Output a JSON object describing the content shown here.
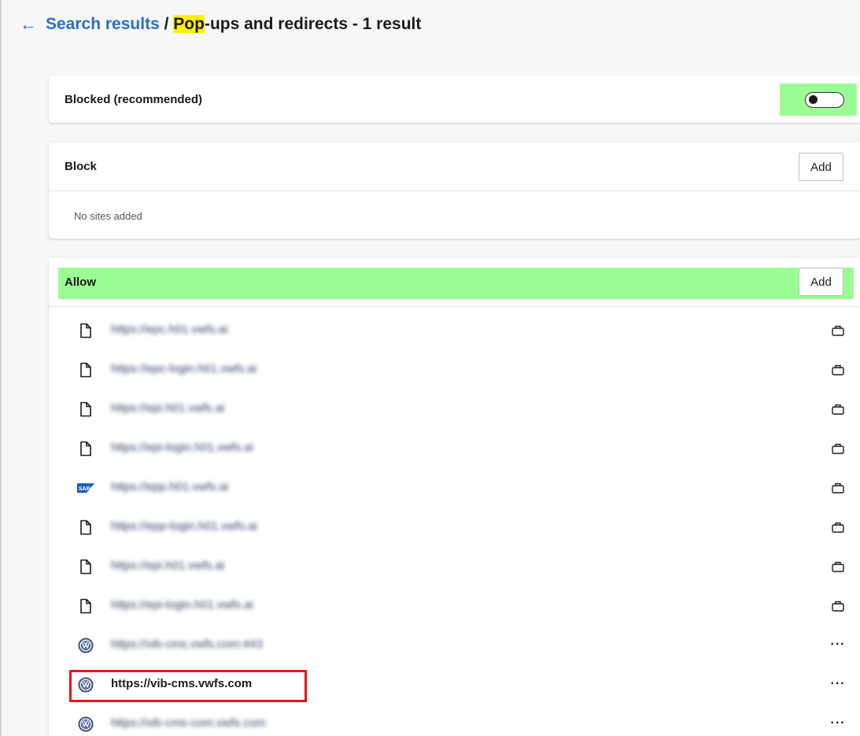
{
  "header": {
    "back_label": "←",
    "breadcrumb_link": "Search results",
    "separator": "/",
    "highlight": "Pop",
    "title_rest": "-ups and redirects - 1 result"
  },
  "blocked_card": {
    "label": "Blocked (recommended)",
    "toggle_on": false
  },
  "block_card": {
    "title": "Block",
    "add_label": "Add",
    "empty_text": "No sites added"
  },
  "allow_card": {
    "title": "Allow",
    "add_label": "Add",
    "sites": [
      {
        "url": "https://epc.h01.vwfs.ai",
        "icon": "file-icon",
        "action": "briefcase-icon",
        "blurred": true
      },
      {
        "url": "https://epc-login.h01.vwfs.ai",
        "icon": "file-icon",
        "action": "briefcase-icon",
        "blurred": true
      },
      {
        "url": "https://epi.h01.vwfs.ai",
        "icon": "file-icon",
        "action": "briefcase-icon",
        "blurred": true
      },
      {
        "url": "https://epi-login.h01.vwfs.ai",
        "icon": "file-icon",
        "action": "briefcase-icon",
        "blurred": true
      },
      {
        "url": "https://epp.h01.vwfs.ai",
        "icon": "sap-icon",
        "action": "briefcase-icon",
        "blurred": true
      },
      {
        "url": "https://epp-login.h01.vwfs.ai",
        "icon": "file-icon",
        "action": "briefcase-icon",
        "blurred": true
      },
      {
        "url": "https://epi.h01.vwfs.ai",
        "icon": "file-icon",
        "action": "briefcase-icon",
        "blurred": true
      },
      {
        "url": "https://epi-login.h01.vwfs.ai",
        "icon": "file-icon",
        "action": "briefcase-icon",
        "blurred": true
      },
      {
        "url": "https://vib-cms.vwfs.com:443",
        "icon": "vw-icon",
        "action": "more-icon",
        "blurred": true
      },
      {
        "url": "https://vib-cms.vwfs.com",
        "icon": "vw-icon",
        "action": "more-icon",
        "blurred": false
      },
      {
        "url": "https://vib-cms-com.vwfs.com",
        "icon": "vw-icon",
        "action": "more-icon",
        "blurred": true
      }
    ],
    "more_glyph": "···"
  },
  "colors": {
    "accent": "#2a6fc4",
    "highlight_yellow": "#fff200",
    "annotation_green": "#9afe94",
    "annotation_red": "#e8151b"
  }
}
